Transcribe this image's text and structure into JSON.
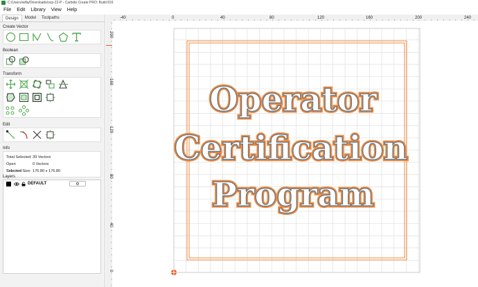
{
  "window": {
    "title": "C:/Users/willa/Downloads/ocp-22-P - Carbide Create PRO: Build 816"
  },
  "menu": {
    "items": [
      "File",
      "Edit",
      "Library",
      "View",
      "Help"
    ]
  },
  "tabs": [
    "Design",
    "Model",
    "Toolpaths"
  ],
  "sections": {
    "create_vector": "Create Vector",
    "boolean": "Boolean",
    "transform": "Transform",
    "edit": "Edit",
    "info": "Info",
    "layers": "Layers"
  },
  "tools": {
    "create_vector": [
      "circle-icon",
      "rectangle-icon",
      "curve-icon",
      "polyline-icon",
      "polygon-icon",
      "text-icon"
    ],
    "boolean": [
      "union-icon",
      "subtract-icon"
    ],
    "transform_row1": [
      "move-icon",
      "scale-icon",
      "rotate-icon",
      "align-icon",
      "mirror-icon"
    ],
    "transform_row2": [
      "offset-icon",
      "inset-icon",
      "outline-icon",
      "group-icon"
    ],
    "transform_row3": [
      "array-icon",
      "circular-array-icon"
    ],
    "edit": [
      "node-edit-icon",
      "fillet-icon",
      "trim-icon",
      "join-icon"
    ]
  },
  "info": {
    "rows": [
      {
        "label": "Total Selected:",
        "value": "39 Vectors"
      },
      {
        "label": "Open Selected:",
        "value": "0 Vectors"
      },
      {
        "label": "Selected Size:",
        "value": "176.80 x 176.80"
      }
    ]
  },
  "layers": {
    "items": [
      {
        "name": "DEFAULT",
        "color": "#000000"
      }
    ]
  },
  "ruler": {
    "x_ticks": [
      "-40",
      "0",
      "40",
      "80",
      "120",
      "160",
      "200",
      "240"
    ],
    "y_ticks": [
      "200",
      "160",
      "120",
      "80",
      "40",
      "0"
    ]
  },
  "design": {
    "lines": [
      "Operator",
      "Certification",
      "Program"
    ],
    "outline_color": "#ef8a3e",
    "accent_color": "#e8531f"
  },
  "colors": {
    "tool_green": "#4ea84e",
    "panel_bg": "#f2f2f2"
  }
}
